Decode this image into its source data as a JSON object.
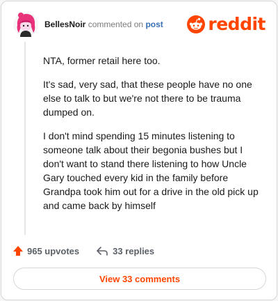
{
  "header": {
    "username": "BellesNoir",
    "commented_text": "commented on",
    "post_link": "post",
    "logo_text": "reddit"
  },
  "comment": {
    "paragraphs": [
      "NTA, former retail here too.",
      "It's sad, very sad, that these people have no one else to talk to but we're not there to be trauma dumped on.",
      "I don't mind spending 15 minutes listening to someone talk about their begonia bushes but I don't want to stand there listening to how Uncle Gary touched every kid in the family before Grandpa took him out for a drive in the old pick up and came back by himself"
    ]
  },
  "actions": {
    "upvotes": "965 upvotes",
    "replies": "33 replies"
  },
  "view_button": "View 33 comments",
  "colors": {
    "brand": "#ff4500",
    "link": "#3a6fb5",
    "muted": "#7c7c7c"
  },
  "icons": {
    "avatar": "avatar",
    "logo": "reddit-snoo-icon",
    "upvote": "upvote-arrow-icon",
    "reply": "reply-arrow-icon"
  }
}
